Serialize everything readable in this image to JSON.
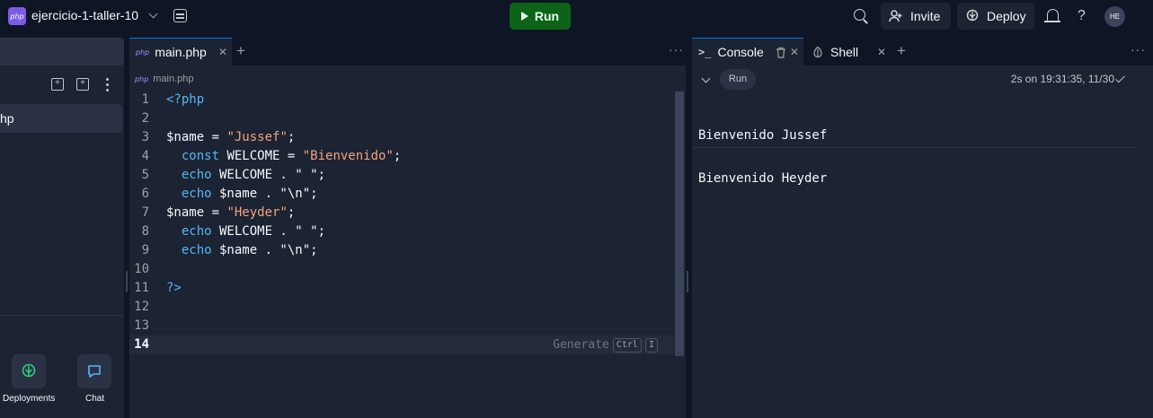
{
  "header": {
    "repl_logo_text": "php",
    "repl_name": "ejercicio-1-taller-10",
    "run_label": "Run",
    "invite_label": "Invite",
    "deploy_label": "Deploy",
    "avatar_initials": "HE",
    "help_glyph": "?"
  },
  "sidebar": {
    "file_label": "hp",
    "dock": [
      {
        "label": "Deployments",
        "icon": "deployments-icon"
      },
      {
        "label": "Chat",
        "icon": "chat-icon"
      }
    ]
  },
  "editor": {
    "tab_icon_text": "php",
    "active_tab": "main.php",
    "breadcrumb_file": "main.php",
    "generate_hint": "Generate",
    "shortcut_keys": [
      "Ctrl",
      "I"
    ],
    "lines": [
      {
        "num": "1",
        "parts": [
          [
            "kw",
            "<?php"
          ]
        ]
      },
      {
        "num": "2",
        "parts": []
      },
      {
        "num": "3",
        "parts": [
          [
            "sym",
            "$name = "
          ],
          [
            "str",
            "\"Jussef\""
          ],
          [
            "sym",
            ";"
          ]
        ]
      },
      {
        "num": "4",
        "parts": [
          [
            "sym",
            "  "
          ],
          [
            "kw",
            "const"
          ],
          [
            "sym",
            " WELCOME = "
          ],
          [
            "str",
            "\"Bienvenido\""
          ],
          [
            "sym",
            ";"
          ]
        ]
      },
      {
        "num": "5",
        "parts": [
          [
            "sym",
            "  "
          ],
          [
            "kw",
            "echo"
          ],
          [
            "sym",
            " WELCOME . \" \";"
          ]
        ]
      },
      {
        "num": "6",
        "parts": [
          [
            "sym",
            "  "
          ],
          [
            "kw",
            "echo"
          ],
          [
            "sym",
            " $name . \"\\n\";"
          ]
        ]
      },
      {
        "num": "7",
        "parts": [
          [
            "sym",
            "$name = "
          ],
          [
            "str",
            "\"Heyder\""
          ],
          [
            "sym",
            ";"
          ]
        ]
      },
      {
        "num": "8",
        "parts": [
          [
            "sym",
            "  "
          ],
          [
            "kw",
            "echo"
          ],
          [
            "sym",
            " WELCOME . \" \";"
          ]
        ]
      },
      {
        "num": "9",
        "parts": [
          [
            "sym",
            "  "
          ],
          [
            "kw",
            "echo"
          ],
          [
            "sym",
            " $name . \"\\n\";"
          ]
        ]
      },
      {
        "num": "10",
        "parts": []
      },
      {
        "num": "11",
        "parts": [
          [
            "kw",
            "?>"
          ]
        ]
      },
      {
        "num": "12",
        "parts": []
      },
      {
        "num": "13",
        "parts": []
      },
      {
        "num": "14",
        "parts": []
      }
    ],
    "active_line": "14"
  },
  "console": {
    "tabs": [
      {
        "label": "Console",
        "glyph": ">_"
      },
      {
        "label": "Shell",
        "glyph": ""
      }
    ],
    "run_chip": "Run",
    "run_meta": "2s on 19:31:35, 11/30",
    "output": [
      "Bienvenido Jussef",
      "Bienvenido Heyder"
    ]
  },
  "colors": {
    "background": "#0e1525",
    "panel": "#1c2333",
    "run_button": "#0d6418",
    "keyword": "#56b6f2",
    "string": "#f0a57a",
    "accent": "#0079f2"
  }
}
